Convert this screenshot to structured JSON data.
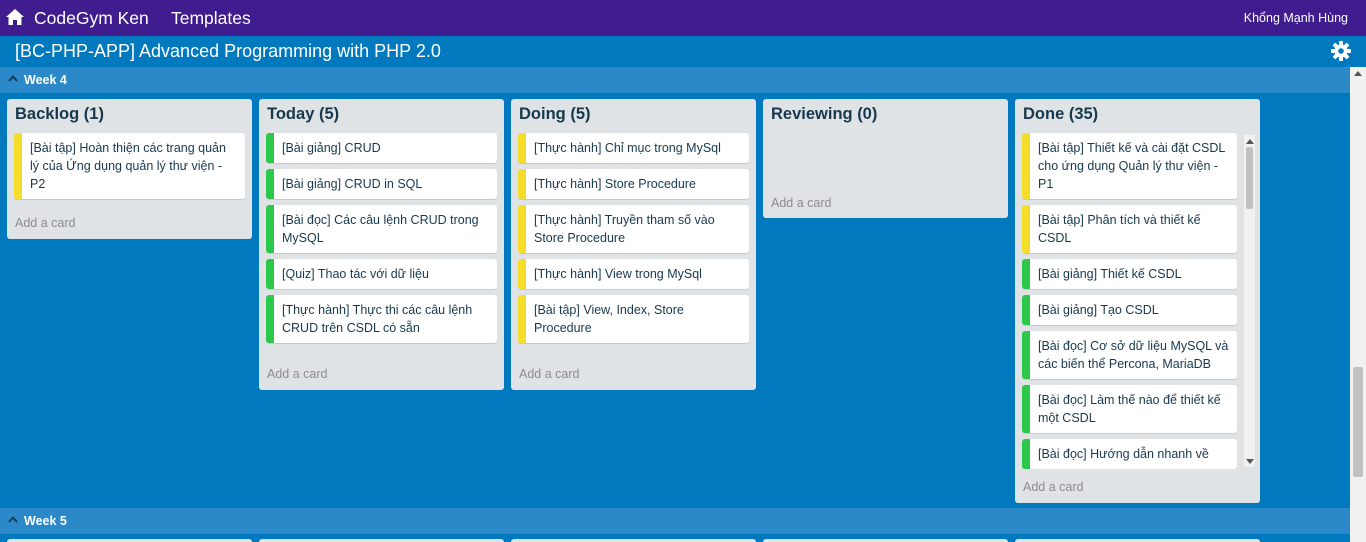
{
  "header": {
    "brand": "CodeGym Ken",
    "templates_label": "Templates",
    "user_name": "Khổng Mạnh Hùng",
    "home_icon": "home-icon"
  },
  "board": {
    "title": "[BC-PHP-APP] Advanced Programming with PHP 2.0",
    "settings_icon": "gear-icon"
  },
  "colors": {
    "topbar": "#3f1d8f",
    "board_bg": "#0079bf",
    "week_header": "#2b88c9",
    "label_yellow": "#f5dd29",
    "label_green": "#2bc84a"
  },
  "weeks": [
    {
      "label": "Week 4",
      "lists": [
        {
          "title": "Backlog (1)",
          "cards": [
            {
              "text": "[Bài tập] Hoàn thiện các trang quản lý của Ứng dụng quản lý thư viện - P2",
              "label": "yellow"
            }
          ],
          "add_label": "Add a card"
        },
        {
          "title": "Today (5)",
          "cards": [
            {
              "text": "[Bài giảng] CRUD",
              "label": "green"
            },
            {
              "text": "[Bài giảng] CRUD in SQL",
              "label": "green"
            },
            {
              "text": "[Bài đọc] Các câu lệnh CRUD trong MySQL",
              "label": "green"
            },
            {
              "text": "[Quiz] Thao tác với dữ liệu",
              "label": "green"
            },
            {
              "text": "[Thực hành] Thực thi các câu lệnh CRUD trên CSDL có sẵn",
              "label": "green"
            }
          ],
          "add_label": "Add a card"
        },
        {
          "title": "Doing (5)",
          "cards": [
            {
              "text": "[Thực hành] Chỉ mục trong MySql",
              "label": "yellow"
            },
            {
              "text": "[Thực hành] Store Procedure",
              "label": "yellow"
            },
            {
              "text": "[Thực hành] Truyền tham số vào Store Procedure",
              "label": "yellow"
            },
            {
              "text": "[Thực hành] View trong MySql",
              "label": "yellow"
            },
            {
              "text": "[Bài tập] View, Index, Store Procedure",
              "label": "yellow"
            }
          ],
          "add_label": "Add a card"
        },
        {
          "title": "Reviewing (0)",
          "cards": [],
          "add_label": "Add a card"
        },
        {
          "title": "Done (35)",
          "cards": [
            {
              "text": "[Bài tập] Thiết kế và cài đặt CSDL cho ứng dụng Quản lý thư viện - P1",
              "label": "yellow"
            },
            {
              "text": "[Bài tập] Phân tích và thiết kế CSDL",
              "label": "yellow"
            },
            {
              "text": "[Bài giảng] Thiết kế CSDL",
              "label": "green"
            },
            {
              "text": "[Bài giảng] Tạo CSDL",
              "label": "green"
            },
            {
              "text": "[Bài đọc] Cơ sở dữ liệu MySQL và các biến thể Percona, MariaDB",
              "label": "green"
            },
            {
              "text": "[Bài đọc] Làm thế nào để thiết kế một CSDL",
              "label": "green"
            },
            {
              "text": "[Bài đọc] Hướng dẫn nhanh về",
              "label": "green"
            }
          ],
          "add_label": "Add a card"
        }
      ]
    },
    {
      "label": "Week 5"
    }
  ]
}
